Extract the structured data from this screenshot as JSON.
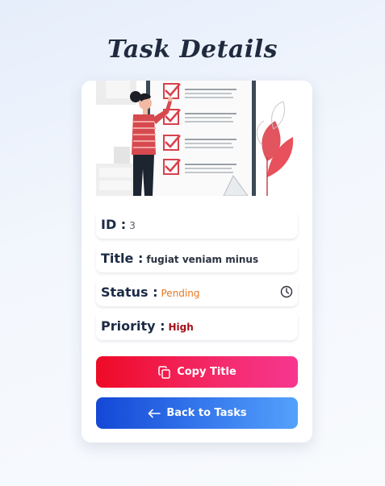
{
  "page": {
    "title": "Task Details"
  },
  "task": {
    "id_label": "ID :",
    "id_value": "3",
    "title_label": "Title :",
    "title_value": "fugiat veniam minus",
    "status_label": "Status :",
    "status_value": "Pending",
    "priority_label": "Priority :",
    "priority_value": "High"
  },
  "actions": {
    "copy_label": "Copy Title",
    "copy_icon": "copy-icon",
    "back_label": "Back to Tasks",
    "back_icon": "arrow-left-icon"
  },
  "icons": {
    "status_icon": "clock-icon"
  },
  "colors": {
    "status_pending": "#e87722",
    "priority_high": "#a3101a",
    "copy_gradient_start": "#ee0a26",
    "copy_gradient_end": "#f73690",
    "back_gradient_start": "#1348d6",
    "back_gradient_end": "#54a1fb"
  }
}
